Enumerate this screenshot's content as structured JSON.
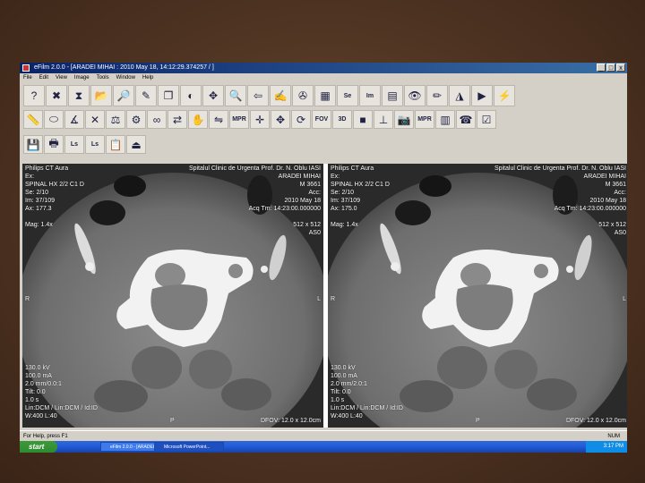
{
  "window": {
    "title": "eFilm 2.0.0 - [ARADEI MIHAI : 2010 May 18, 14:12:29.374257 / ]",
    "controls": [
      "_",
      "□",
      "x"
    ]
  },
  "menu": [
    "File",
    "Edit",
    "View",
    "Image",
    "Tools",
    "Window",
    "Help"
  ],
  "toolbar": {
    "row1": [
      {
        "icon": "help-pointer-icon",
        "glyph": "?"
      },
      {
        "icon": "close-study-icon",
        "glyph": "✖"
      },
      {
        "icon": "hourglass-icon",
        "glyph": "⧗"
      },
      {
        "icon": "open-study-icon",
        "glyph": "📂"
      },
      {
        "icon": "magnifier-open-icon",
        "glyph": "🔎"
      },
      {
        "icon": "export-icon",
        "glyph": "✎"
      },
      {
        "icon": "stack-icon",
        "glyph": "❐"
      },
      {
        "icon": "window-level-icon",
        "glyph": "◐"
      },
      {
        "icon": "pan-icon",
        "glyph": "✥"
      },
      {
        "icon": "zoom-icon",
        "glyph": "🔍"
      },
      {
        "icon": "back-arrow-icon",
        "glyph": "⇦"
      },
      {
        "icon": "annotate-icon",
        "glyph": "✍"
      },
      {
        "icon": "film-reel-icon",
        "glyph": "✇"
      },
      {
        "icon": "layout-grid-icon",
        "glyph": "▦"
      },
      {
        "icon": "series-layout-icon",
        "glyph": "Se"
      },
      {
        "icon": "image-layout-icon",
        "glyph": "Im"
      },
      {
        "icon": "tile-icon",
        "glyph": "▤"
      },
      {
        "icon": "eye-icon",
        "glyph": "👁"
      },
      {
        "icon": "edit-pencil-icon",
        "glyph": "✏"
      },
      {
        "icon": "shutter-icon",
        "glyph": "◮"
      },
      {
        "icon": "cine-play-icon",
        "glyph": "▶"
      },
      {
        "icon": "cine-tool-icon",
        "glyph": "⚡"
      }
    ],
    "row2": [
      {
        "icon": "ruler-icon",
        "glyph": "📏"
      },
      {
        "icon": "ellipse-roi-icon",
        "glyph": "⬭"
      },
      {
        "icon": "angle-icon",
        "glyph": "∡"
      },
      {
        "icon": "delete-measure-icon",
        "glyph": "✕"
      },
      {
        "icon": "cobb-angle-icon",
        "glyph": "⚖"
      },
      {
        "icon": "calibrate-icon",
        "glyph": "⚙"
      },
      {
        "icon": "link-series-icon",
        "glyph": "∞"
      },
      {
        "icon": "sync-icon",
        "glyph": "⇄"
      },
      {
        "icon": "hand-icon",
        "glyph": "✋"
      },
      {
        "icon": "flip-icon",
        "glyph": "⇋"
      },
      {
        "icon": "mpr-icon",
        "glyph": "MPR"
      },
      {
        "icon": "crosshair-icon",
        "glyph": "✛"
      },
      {
        "icon": "move-icon",
        "glyph": "✥"
      },
      {
        "icon": "rotate-icon",
        "glyph": "⟳"
      },
      {
        "icon": "fov-icon",
        "glyph": "FOV"
      },
      {
        "icon": "3d-icon",
        "glyph": "3D"
      },
      {
        "icon": "black-square-icon",
        "glyph": "■"
      },
      {
        "icon": "axes-icon",
        "glyph": "⊥"
      },
      {
        "icon": "camera-icon",
        "glyph": "📷"
      },
      {
        "icon": "mpr2-icon",
        "glyph": "MPR"
      },
      {
        "icon": "histogram-icon",
        "glyph": "▥"
      },
      {
        "icon": "phone-icon",
        "glyph": "☎"
      },
      {
        "icon": "check-icon",
        "glyph": "☑"
      }
    ],
    "row3": [
      {
        "icon": "save-icon",
        "glyph": "💾"
      },
      {
        "icon": "print-preview-icon",
        "glyph": "🖶"
      },
      {
        "icon": "ls-left-icon",
        "glyph": "Ls"
      },
      {
        "icon": "ls-right-icon",
        "glyph": "Ls"
      },
      {
        "icon": "report-icon",
        "glyph": "📋"
      },
      {
        "icon": "exit-icon",
        "glyph": "⏏"
      }
    ]
  },
  "viewports": [
    {
      "tl": [
        "Philips CT Aura",
        "Ex:",
        "SPINAL HX 2/2 C1 D",
        "Se: 2/10",
        "Im: 37/109",
        "Ax: 177.3",
        "",
        "Mag: 1.4x"
      ],
      "tr": [
        "Spitalul Clinic de Urgenta Prof. Dr. N. Oblu IASI",
        "ARADEI MIHAI",
        "M 3661",
        "Acc:",
        "2010 May 18",
        "Acq Tm: 14:23:00.000000",
        "",
        "512 x 512",
        "AS0"
      ],
      "ml": "R",
      "mr": "L",
      "bl": [
        "130.0 kV",
        "100.0 mA",
        "2.0 mm/0.0:1",
        "Tilt: 0.0",
        "1.0 s",
        "Lin:DCM / Lin:DCM / Id:ID",
        "W:400 L:40"
      ],
      "bc": "P",
      "br": "DFOV: 12.0 x 12.0cm"
    },
    {
      "tl": [
        "Philips CT Aura",
        "Ex:",
        "SPINAL HX 2/2 C1 D",
        "Se: 2/10",
        "Im: 37/109",
        "Ax: 175.0",
        "",
        "Mag: 1.4x"
      ],
      "tr": [
        "Spitalul Clinic de Urgenta Prof. Dr. N. Oblu IASI",
        "ARADEI MIHAI",
        "M 3661",
        "Acc:",
        "2010 May 18",
        "Acq Tm: 14:23:00.000000",
        "",
        "512 x 512",
        "AS0"
      ],
      "ml": "R",
      "mr": "L",
      "bl": [
        "130.0 kV",
        "100.0 mA",
        "2.0 mm/2.0:1",
        "Tilt: 0.0",
        "1.0 s",
        "Lin:DCM / Lin:DCM / Id:ID",
        "W:400 L:40"
      ],
      "bc": "P",
      "br": "DFOV: 12.0 x 12.0cm"
    }
  ],
  "status": "For Help, press F1",
  "status_right": "NUM",
  "taskbar": {
    "start": "start",
    "tasks": [
      "eFilm 2.0.0 - [ARADEI...",
      "Microsoft PowerPoint..."
    ],
    "clock": "3:17 PM"
  }
}
